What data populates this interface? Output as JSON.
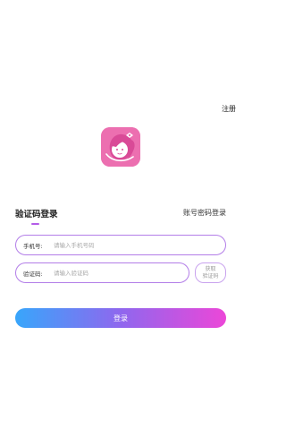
{
  "header": {
    "register_label": "注册"
  },
  "logo": {
    "icon": "girl-avatar-logo-icon",
    "color": "#ec6fb0"
  },
  "tabs": {
    "active_label": "验证码登录",
    "inactive_label": "账号密码登录"
  },
  "form": {
    "phone": {
      "label": "手机号:",
      "value": "",
      "placeholder": "请输入手机号码"
    },
    "code": {
      "label": "验证码:",
      "value": "",
      "placeholder": "请输入验证码"
    },
    "get_code_line1": "获取",
    "get_code_line2": "验证码"
  },
  "login_button_label": "登录",
  "colors": {
    "accent_border": "#b37ee8",
    "gradient_start": "#38a6fb",
    "gradient_end": "#ec47d8"
  }
}
